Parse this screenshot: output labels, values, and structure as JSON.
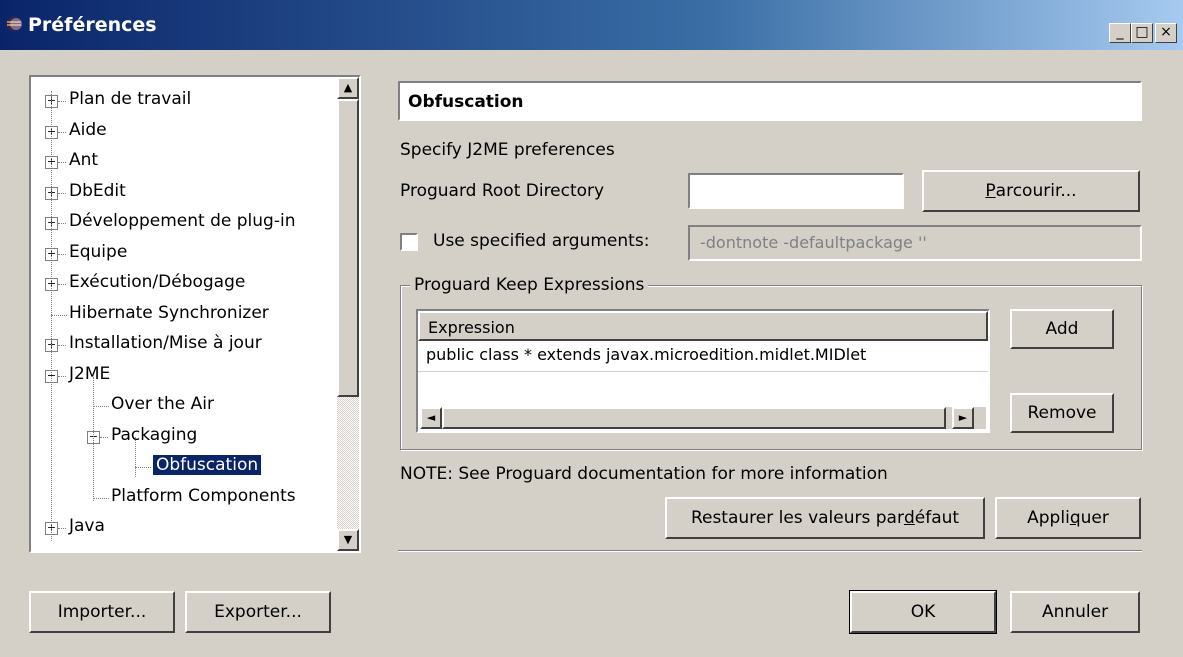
{
  "window": {
    "title": "Préférences",
    "min_btn": "_",
    "max_btn": "□",
    "close_btn": "×"
  },
  "tree": {
    "items": [
      {
        "label": "Plan de travail",
        "expander": "+"
      },
      {
        "label": "Aide",
        "expander": "+"
      },
      {
        "label": "Ant",
        "expander": "+"
      },
      {
        "label": "DbEdit",
        "expander": "+"
      },
      {
        "label": "Développement de plug-in",
        "expander": "+"
      },
      {
        "label": "Equipe",
        "expander": "+"
      },
      {
        "label": "Exécution/Débogage",
        "expander": "+"
      },
      {
        "label": "Hibernate Synchronizer",
        "expander": ""
      },
      {
        "label": "Installation/Mise à jour",
        "expander": "+"
      },
      {
        "label": "J2ME",
        "expander": "−"
      },
      {
        "label": "Over the Air",
        "expander": ""
      },
      {
        "label": "Packaging",
        "expander": "−"
      },
      {
        "label": "Obfuscation",
        "expander": ""
      },
      {
        "label": "Platform Components",
        "expander": ""
      },
      {
        "label": "Java",
        "expander": "+"
      }
    ],
    "selected": "Obfuscation",
    "scroll_up": "▲",
    "scroll_down": "▼"
  },
  "page": {
    "heading": "Obfuscation",
    "description": "Specify J2ME preferences",
    "root_dir_label": "Proguard Root Directory",
    "root_dir_value": "",
    "browse_button_pre": "",
    "browse_button_mn": "P",
    "browse_button_post": "arcourir...",
    "use_args_label": "Use specified arguments:",
    "use_args_checked": false,
    "args_value": "-dontnote -defaultpackage ''",
    "group_title": "Proguard Keep Expressions",
    "table_header": "Expression",
    "table_rows": [
      "public class * extends javax.microedition.midlet.MIDlet"
    ],
    "add_button": "Add",
    "remove_button": "Remove",
    "note": "NOTE: See Proguard documentation for more information",
    "restore_pre": "Restaurer les valeurs par ",
    "restore_mn": "d",
    "restore_post": "éfaut",
    "apply_pre": "Appli",
    "apply_mn": "q",
    "apply_post": "uer",
    "hscroll_left": "◄",
    "hscroll_right": "►"
  },
  "footer": {
    "import_button": "Importer...",
    "export_button": "Exporter...",
    "ok_button": "OK",
    "cancel_button": "Annuler"
  }
}
